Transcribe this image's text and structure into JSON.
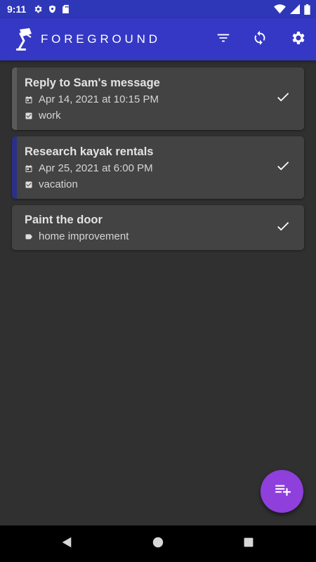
{
  "status_bar": {
    "time": "9:11",
    "icons": [
      "gear-icon",
      "shield-icon",
      "sd-card-icon",
      "wifi-icon",
      "signal-icon",
      "battery-icon"
    ]
  },
  "app_bar": {
    "title": "FOREGROUND",
    "logo": "desk-lamp-icon",
    "actions": [
      "filter-icon",
      "sync-icon",
      "settings-icon"
    ],
    "color": "#3538c5"
  },
  "tasks": [
    {
      "title": "Reply to Sam's message",
      "date": "Apr 14, 2021 at 10:15 PM",
      "tag": "work",
      "tag_icon": "checkbox-icon",
      "accent": "#5a5a5a"
    },
    {
      "title": "Research kayak rentals",
      "date": "Apr 25, 2021 at 6:00 PM",
      "tag": "vacation",
      "tag_icon": "checkbox-icon",
      "accent": "#2b2f86"
    },
    {
      "title": "Paint the door",
      "tag": "home improvement",
      "tag_icon": "label-icon",
      "accent": "#434343"
    }
  ],
  "fab": {
    "icon": "playlist-add-icon",
    "color": "#8e3fdc"
  },
  "nav_bar": {
    "buttons": [
      "back-icon",
      "home-icon",
      "recents-icon"
    ]
  }
}
